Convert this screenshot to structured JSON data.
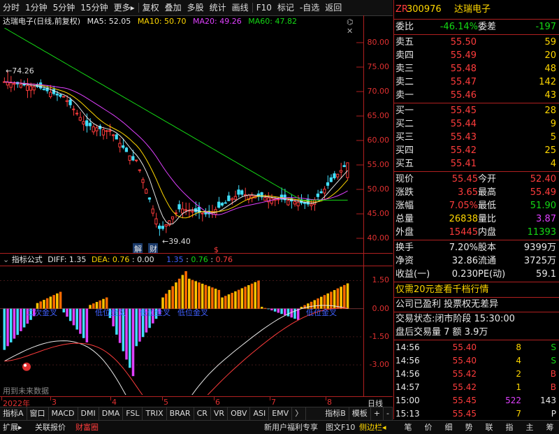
{
  "toolbar": {
    "items": [
      "分时",
      "1分钟",
      "5分钟",
      "15分钟",
      "更多▸",
      "复权",
      "叠加",
      "多股",
      "统计",
      "画线",
      "F10",
      "标记",
      "-自选",
      "返回"
    ]
  },
  "chart_header": {
    "stock_name": "达瑞电子",
    "mode": "(日线,前复权)",
    "ma5": "MA5: 52.05",
    "ma10": "MA10: 50.70",
    "ma20": "MA20: 49.26",
    "ma60": "MA60: 47.82"
  },
  "main_axis": [
    "80.00",
    "75.00",
    "70.00",
    "65.00",
    "60.00",
    "55.00",
    "50.00",
    "45.00",
    "40.00"
  ],
  "annotations": {
    "high_label": "74.26",
    "low_label": "39.40",
    "jie": "解",
    "cai": "财",
    "s_mark": "$"
  },
  "sub_header": {
    "name": "指标公式",
    "diff": "DIFF: 1.35",
    "dea": "DEA: 0.76",
    "macd": ": 0.00",
    "v1": "1.35",
    "v2": "0.76",
    "v3": "0.76"
  },
  "sub_axis": [
    "1.50",
    "0.00",
    "-1.50",
    "-3.00"
  ],
  "sub_labels": [
    "二次金叉",
    "低位金叉",
    "低位金叉",
    "低位金叉",
    "低位金叉"
  ],
  "future_data_note": "用到未来数据",
  "dates": [
    "2022年",
    "3",
    "4",
    "5",
    "6",
    "7",
    "8"
  ],
  "dateaxis_right": "日线",
  "tabs": [
    "指标A",
    "窗口",
    "MACD",
    "DMI",
    "DMA",
    "FSL",
    "TRIX",
    "BRAR",
    "CR",
    "VR",
    "OBV",
    "ASI",
    "EMV",
    "〉",
    "指标B",
    "模板",
    "+",
    "-"
  ],
  "bottombar": {
    "left": [
      "扩展▸",
      "关联报价",
      "财富圈"
    ],
    "right": [
      "新用户福利专享",
      "图文F10",
      "侧边栏◂"
    ]
  },
  "quote": {
    "code": "300976",
    "name": "达瑞电子",
    "wb_label": "委比",
    "wb_value": "-46.14%",
    "wc_label": "委差",
    "wc_value": "-197",
    "asks": [
      {
        "label": "卖五",
        "price": "55.50",
        "vol": "59"
      },
      {
        "label": "卖四",
        "price": "55.49",
        "vol": "20"
      },
      {
        "label": "卖三",
        "price": "55.48",
        "vol": "48"
      },
      {
        "label": "卖二",
        "price": "55.47",
        "vol": "142"
      },
      {
        "label": "卖一",
        "price": "55.46",
        "vol": "43"
      }
    ],
    "bids": [
      {
        "label": "买一",
        "price": "55.45",
        "vol": "28"
      },
      {
        "label": "买二",
        "price": "55.44",
        "vol": "9"
      },
      {
        "label": "买三",
        "price": "55.43",
        "vol": "5"
      },
      {
        "label": "买四",
        "price": "55.42",
        "vol": "25"
      },
      {
        "label": "买五",
        "price": "55.41",
        "vol": "4"
      }
    ],
    "stats": [
      {
        "l1": "现价",
        "v1": "55.45",
        "l2": "今开",
        "v2": "52.40"
      },
      {
        "l1": "涨跌",
        "v1": "3.65",
        "l2": "最高",
        "v2": "55.49"
      },
      {
        "l1": "涨幅",
        "v1": "7.05%",
        "l2": "最低",
        "v2": "51.90"
      },
      {
        "l1": "总量",
        "v1": "26838",
        "l2": "量比",
        "v2": "3.87"
      },
      {
        "l1": "外盘",
        "v1": "15445",
        "l2": "内盘",
        "v2": "11393"
      }
    ],
    "stats2": [
      {
        "l1": "换手",
        "v1": "7.20%",
        "l2": "股本",
        "v2": "9399万"
      },
      {
        "l1": "净资",
        "v1": "32.86",
        "l2": "流通",
        "v2": "3725万"
      },
      {
        "l1": "收益(一)",
        "v1": "0.230",
        "l2": "PE(动)",
        "v2": "59.1"
      }
    ],
    "promo": "仅需20元查看千档行情",
    "notice": "公司已盈利 投票权无差异",
    "trade_status": "交易状态:闭市阶段 15:30:00",
    "after_hours": "盘后交易量 7 额 3.9万",
    "ticks": [
      {
        "t": "14:56",
        "p": "55.40",
        "v": "8",
        "d": "S"
      },
      {
        "t": "14:56",
        "p": "55.40",
        "v": "4",
        "d": "S"
      },
      {
        "t": "14:56",
        "p": "55.42",
        "v": "2",
        "d": "B"
      },
      {
        "t": "14:57",
        "p": "55.42",
        "v": "1",
        "d": "B"
      },
      {
        "t": "15:00",
        "p": "55.45",
        "v": "522",
        "d": "143"
      },
      {
        "t": "15:13",
        "p": "55.45",
        "v": "7",
        "d": "P"
      }
    ],
    "bottom_tabs": [
      "笔",
      "价",
      "细",
      "势",
      "联",
      "指",
      "主",
      "筹"
    ]
  }
}
